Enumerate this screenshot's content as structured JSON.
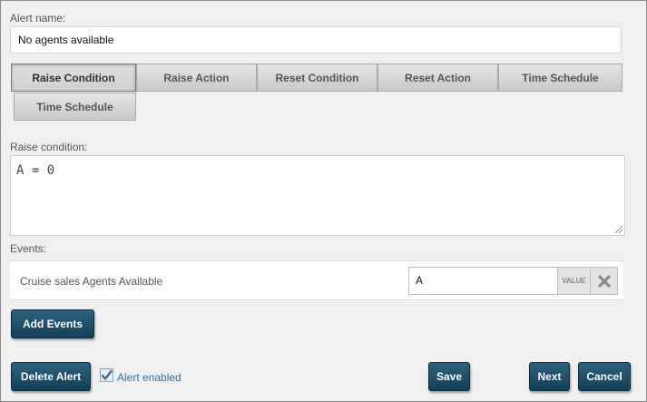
{
  "alert_name": {
    "label": "Alert name:",
    "value": "No agents available"
  },
  "tabs": [
    {
      "label": "Raise Condition",
      "active": true
    },
    {
      "label": "Raise Action",
      "active": false
    },
    {
      "label": "Reset Condition",
      "active": false
    },
    {
      "label": "Reset Action",
      "active": false
    },
    {
      "label": "Time Schedule",
      "active": false
    },
    {
      "label": "Time Schedule",
      "active": false
    }
  ],
  "raise_condition": {
    "label": "Raise condition:",
    "value": "A = 0"
  },
  "events": {
    "label": "Events:",
    "items": [
      {
        "name": "Cruise sales Agents Available",
        "variable": "A",
        "tag": "VALUE"
      }
    ]
  },
  "buttons": {
    "add_events": "Add Events",
    "delete_alert": "Delete Alert",
    "save": "Save",
    "next": "Next",
    "cancel": "Cancel"
  },
  "alert_enabled": {
    "label": "Alert enabled",
    "checked": true
  },
  "colors": {
    "button": "#1d4d68",
    "link": "#3d6f98"
  }
}
